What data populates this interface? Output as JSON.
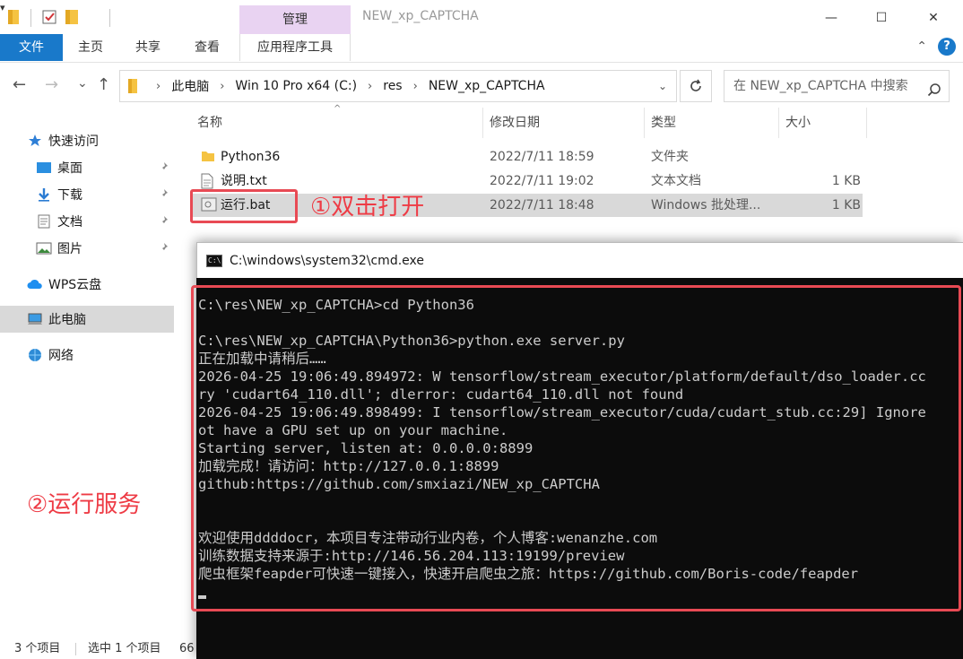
{
  "quick_access": {
    "dropdown_glyph": "▾"
  },
  "window": {
    "title": "NEW_xp_CAPTCHA",
    "context_tab": "管理",
    "minimize_glyph": "—",
    "maximize_glyph": "☐",
    "close_glyph": "✕"
  },
  "ribbon": {
    "tabs": [
      {
        "label": "文件"
      },
      {
        "label": "主页"
      },
      {
        "label": "共享"
      },
      {
        "label": "查看"
      },
      {
        "label": "应用程序工具"
      }
    ],
    "collapse_glyph": "⌃",
    "help_glyph": "?"
  },
  "nav": {
    "back_glyph": "←",
    "forward_glyph": "→",
    "recent_glyph": "⌄",
    "up_glyph": "↑"
  },
  "address": {
    "crumbs": [
      "此电脑",
      "Win 10 Pro x64 (C:)",
      "res",
      "NEW_xp_CAPTCHA"
    ],
    "separator": "›",
    "dropdown_glyph": "⌄"
  },
  "search": {
    "placeholder": "在 NEW_xp_CAPTCHA 中搜索"
  },
  "sidebar": {
    "items": [
      {
        "label": "快速访问",
        "icon": "star-icon",
        "pinned": false
      },
      {
        "label": "桌面",
        "icon": "desktop-icon",
        "pinned": true
      },
      {
        "label": "下载",
        "icon": "download-icon",
        "pinned": true
      },
      {
        "label": "文档",
        "icon": "document-icon",
        "pinned": true
      },
      {
        "label": "图片",
        "icon": "picture-icon",
        "pinned": true
      },
      {
        "label": "WPS云盘",
        "icon": "cloud-icon",
        "pinned": false
      },
      {
        "label": "此电脑",
        "icon": "computer-icon",
        "pinned": false,
        "selected": true
      },
      {
        "label": "网络",
        "icon": "network-icon",
        "pinned": false
      }
    ]
  },
  "file_list": {
    "columns": [
      "名称",
      "修改日期",
      "类型",
      "大小"
    ],
    "sort_glyph": "^",
    "rows": [
      {
        "name": "Python36",
        "date": "2022/7/11 18:59",
        "type": "文件夹",
        "size": "",
        "icon": "folder-icon"
      },
      {
        "name": "说明.txt",
        "date": "2022/7/11 19:02",
        "type": "文本文档",
        "size": "1 KB",
        "icon": "text-file-icon"
      },
      {
        "name": "运行.bat",
        "date": "2022/7/11 18:48",
        "type": "Windows 批处理...",
        "size": "1 KB",
        "icon": "batch-file-icon",
        "selected": true
      }
    ]
  },
  "annotations": {
    "step1": "①双击打开",
    "step2": "②运行服务"
  },
  "status": {
    "item_count": "3 个项目",
    "selected": "选中 1 个项目",
    "size_partial": "66"
  },
  "cmd": {
    "title": "C:\\windows\\system32\\cmd.exe",
    "icon_text": "C:\\",
    "lines": [
      "C:\\res\\NEW_xp_CAPTCHA>cd Python36",
      "",
      "C:\\res\\NEW_xp_CAPTCHA\\Python36>python.exe server.py",
      "正在加载中请稍后……",
      "2026-04-25 19:06:49.894972: W tensorflow/stream_executor/platform/default/dso_loader.cc",
      "ry 'cudart64_110.dll'; dlerror: cudart64_110.dll not found",
      "2026-04-25 19:06:49.898499: I tensorflow/stream_executor/cuda/cudart_stub.cc:29] Ignore",
      "ot have a GPU set up on your machine.",
      "Starting server, listen at: 0.0.0.0:8899",
      "加载完成！请访问：http://127.0.0.1:8899",
      "github:https://github.com/smxiazi/NEW_xp_CAPTCHA",
      "",
      "",
      "欢迎使用ddddocr，本项目专注带动行业内卷，个人博客:wenanzhe.com",
      "训练数据支持来源于:http://146.56.204.113:19199/preview",
      "爬虫框架feapder可快速一键接入，快速开启爬虫之旅：https://github.com/Boris-code/feapder"
    ]
  },
  "colors": {
    "accent": "#1979ca",
    "manage_tab": "#e9d3f2",
    "annotation_red": "#ee3b45",
    "console_bg": "#0c0c0c",
    "console_text": "#cccccc",
    "folder_yellow": "#f5c342"
  }
}
